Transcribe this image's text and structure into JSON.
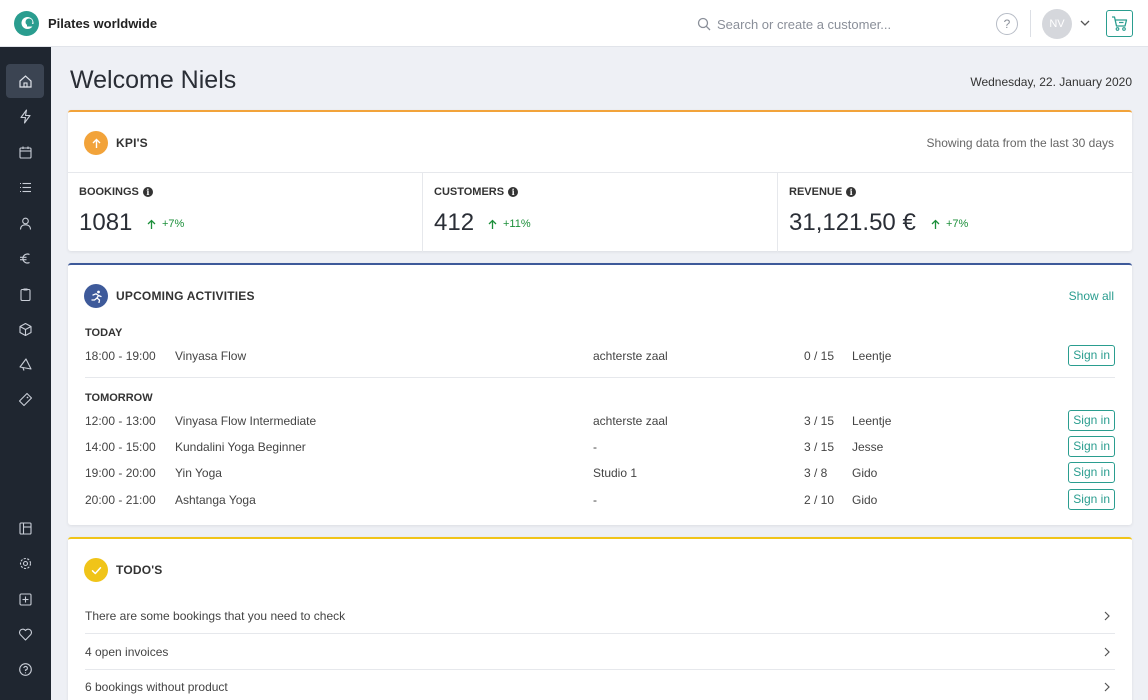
{
  "app": {
    "name": "Pilates worldwide"
  },
  "header": {
    "search_placeholder": "Search or create a customer...",
    "help_label": "?",
    "user_initials": "NV"
  },
  "page": {
    "welcome": "Welcome Niels",
    "date": "Wednesday, 22. January 2020"
  },
  "kpis": {
    "title": "KPI'S",
    "note": "Showing data from the last 30 days",
    "items": [
      {
        "label": "BOOKINGS",
        "value": "1081",
        "delta": "+7%"
      },
      {
        "label": "CUSTOMERS",
        "value": "412",
        "delta": "+11%"
      },
      {
        "label": "REVENUE",
        "value": "31,121.50 €",
        "delta": "+7%"
      }
    ]
  },
  "activities": {
    "title": "UPCOMING ACTIVITIES",
    "show_all": "Show all",
    "signin_label": "Sign in",
    "today": {
      "label": "TODAY",
      "rows": [
        {
          "time": "18:00 - 19:00",
          "name": "Vinyasa Flow",
          "room": "achterste zaal",
          "capacity": "0 / 15",
          "trainer": "Leentje"
        }
      ]
    },
    "tomorrow": {
      "label": "TOMORROW",
      "rows": [
        {
          "time": "12:00 - 13:00",
          "name": "Vinyasa Flow Intermediate",
          "room": "achterste zaal",
          "capacity": "3 / 15",
          "trainer": "Leentje"
        },
        {
          "time": "14:00 - 15:00",
          "name": "Kundalini Yoga Beginner",
          "room": "-",
          "capacity": "3 / 15",
          "trainer": "Jesse"
        },
        {
          "time": "19:00 - 20:00",
          "name": "Yin Yoga",
          "room": "Studio 1",
          "capacity": "3 / 8",
          "trainer": "Gido"
        },
        {
          "time": "20:00 - 21:00",
          "name": "Ashtanga Yoga",
          "room": "-",
          "capacity": "2 / 10",
          "trainer": "Gido"
        }
      ]
    }
  },
  "todos": {
    "title": "TODO'S",
    "items": [
      "There are some bookings that you need to check",
      "4 open invoices",
      "6 bookings without product"
    ]
  },
  "colors": {
    "accent": "#2a9d8f",
    "sidebar": "#1f2630",
    "kpi_border": "#f2a33a",
    "activities_border": "#3e5a9a",
    "todos_border": "#f0c419",
    "positive": "#1c8f3a"
  },
  "icons": {
    "sidebar": [
      "home-icon",
      "lightning-icon",
      "calendar-icon",
      "list-icon",
      "user-icon",
      "euro-icon",
      "clipboard-icon",
      "box-icon",
      "megaphone-icon",
      "ticket-icon",
      "layout-icon",
      "gear-icon",
      "plus-square-icon",
      "heart-icon",
      "help-circle-icon"
    ]
  }
}
